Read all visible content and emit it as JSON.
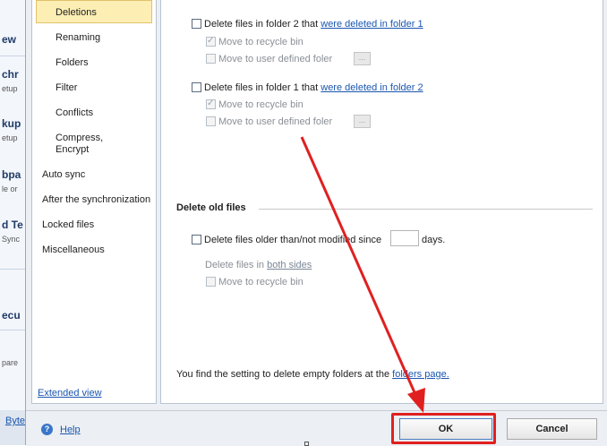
{
  "background": {
    "fragments": [
      "ew",
      "chr",
      "etup",
      "kup",
      "etup",
      "bpa",
      "le or",
      "d Te",
      "Sync",
      "ecu",
      "pare",
      "Byte"
    ]
  },
  "sidebar": {
    "items": [
      {
        "label": "Deletions",
        "selected": true
      },
      {
        "label": "Renaming"
      },
      {
        "label": "Folders"
      },
      {
        "label": "Filter"
      },
      {
        "label": "Conflicts"
      },
      {
        "label": "Compress,\nEncrypt"
      },
      {
        "label": "Auto sync"
      },
      {
        "label": "After the synchronization"
      },
      {
        "label": "Locked files"
      },
      {
        "label": "Miscellaneous"
      }
    ],
    "extended_view": "Extended view"
  },
  "deletions": {
    "group1": {
      "label": "Delete files in folder 2 that",
      "link": "were deleted in folder 1",
      "recycle": "Move to recycle bin",
      "user_folder": "Move to user defined foler",
      "dots": "..."
    },
    "group2": {
      "label": "Delete files in folder 1 that",
      "link": "were deleted in folder 2",
      "recycle": "Move to recycle bin",
      "user_folder": "Move to user defined foler",
      "dots": "..."
    }
  },
  "old_files": {
    "title": "Delete old files",
    "label": "Delete files older than/not modified since",
    "days_value": "",
    "days_unit": "days.",
    "in_label": "Delete files in",
    "in_link": "both sides",
    "recycle": "Move to recycle bin"
  },
  "hint": {
    "text": "You find the setting to delete empty folders at the",
    "link": "folders page."
  },
  "footer": {
    "help": "Help",
    "help_icon": "?",
    "ok": "OK",
    "cancel": "Cancel"
  },
  "colors": {
    "link": "#1a56b0",
    "selection": "#fdeeb4",
    "annotation": "#e02020"
  }
}
